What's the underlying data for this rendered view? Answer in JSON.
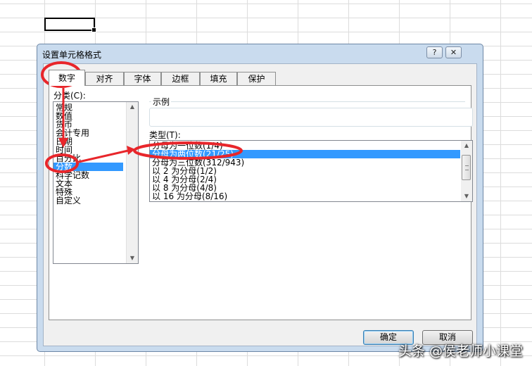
{
  "dialog": {
    "title": "设置单元格格式",
    "help_glyph": "?",
    "close_glyph": "✕",
    "tabs": [
      {
        "label": "数字"
      },
      {
        "label": "对齐"
      },
      {
        "label": "字体"
      },
      {
        "label": "边框"
      },
      {
        "label": "填充"
      },
      {
        "label": "保护"
      }
    ],
    "active_tab": "数字",
    "category": {
      "label": "分类(C):",
      "items": [
        "常规",
        "数值",
        "货币",
        "会计专用",
        "日期",
        "时间",
        "百分比",
        "分数",
        "科学记数",
        "文本",
        "特殊",
        "自定义"
      ],
      "selected": "分数"
    },
    "sample": {
      "label": "示例"
    },
    "type": {
      "label": "类型(T):",
      "items": [
        "分母为一位数(1/4)",
        "分母为两位数(21/25)",
        "分母为三位数(312/943)",
        "以 2 为分母(1/2)",
        "以 4 为分母(2/4)",
        "以 8 为分母(4/8)",
        "以 16 为分母(8/16)"
      ],
      "selected": "分母为两位数(21/25)"
    },
    "ok_label": "确定",
    "cancel_label": "取消"
  },
  "annotation_color": "#e8262b",
  "selection_color": "#3399ff",
  "watermark": "头条 @侯老师小课堂"
}
